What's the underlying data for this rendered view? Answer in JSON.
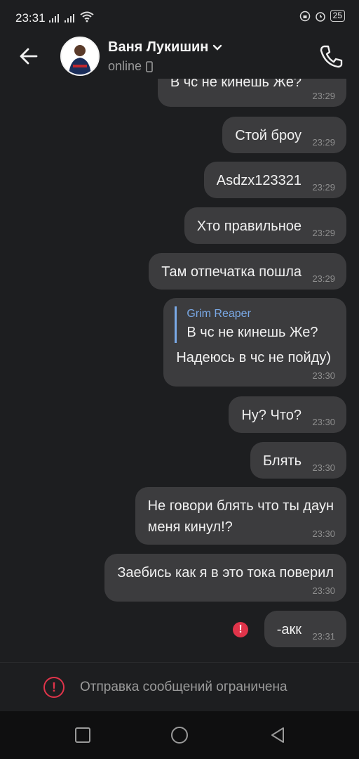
{
  "status_bar": {
    "time": "23:31",
    "battery": "25"
  },
  "header": {
    "contact_name": "Ваня Лукишин",
    "status": "online"
  },
  "messages": [
    {
      "text": "В чс не кинешь Же?",
      "time": "23:29"
    },
    {
      "text": "Стой броу",
      "time": "23:29"
    },
    {
      "text": "Asdzx123321",
      "time": "23:29"
    },
    {
      "text": "Хто правильное",
      "time": "23:29"
    },
    {
      "text": "Там отпечатка пошла",
      "time": "23:29"
    },
    {
      "reply_author": "Grim Reaper",
      "reply_text": "В чс не кинешь Же?",
      "text": "Надеюсь в чс не пойду)",
      "time": "23:30"
    },
    {
      "text": "Ну? Что?",
      "time": "23:30"
    },
    {
      "text": "Блять",
      "time": "23:30"
    },
    {
      "text_line1": "Не говори блять что ты даун",
      "text_line2": "меня кинул!?",
      "time": "23:30"
    },
    {
      "text": "Заебись как я в это тока поверил",
      "time": "23:30"
    },
    {
      "text": "-акк",
      "time": "23:31",
      "error_icon": "!"
    }
  ],
  "restriction": {
    "icon": "!",
    "text": "Отправка сообщений ограничена"
  },
  "colors": {
    "background": "#1d1e20",
    "bubble": "#3c3c3e",
    "accent": "#7aa9e6",
    "error": "#e0344a"
  }
}
